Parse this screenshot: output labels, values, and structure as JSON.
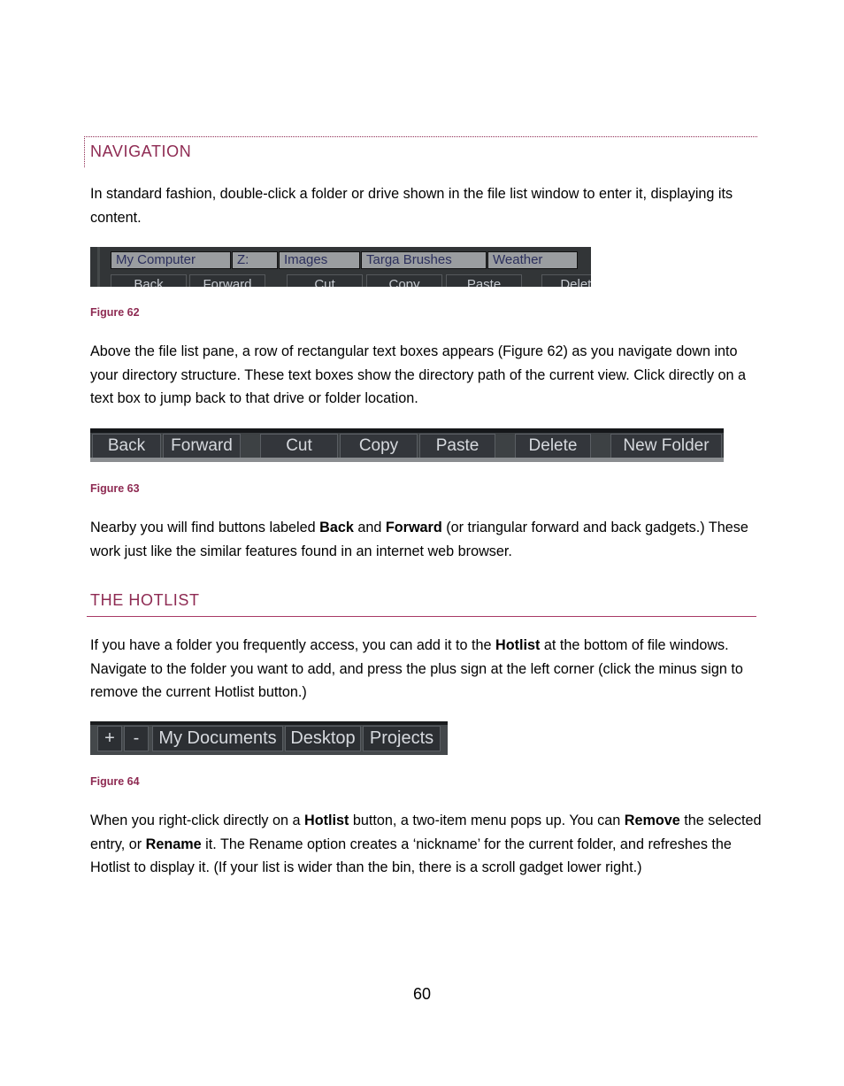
{
  "sections": {
    "navigation": {
      "heading": "NAVIGATION",
      "intro": "In standard fashion, double-click a folder or drive shown in the file list window to enter it, displaying its content."
    },
    "hotlist": {
      "heading": "THE HOTLIST"
    }
  },
  "figures": {
    "fig62": {
      "caption": "Figure 62",
      "path_boxes": [
        "My Computer",
        "Z:",
        "Images",
        "Targa Brushes",
        "Weather"
      ],
      "buttons_partial": [
        "Back",
        "Forward",
        "Cut",
        "Copy",
        "Paste",
        "Delete"
      ]
    },
    "fig63": {
      "caption": "Figure 63",
      "buttons": [
        "Back",
        "Forward",
        "Cut",
        "Copy",
        "Paste",
        "Delete",
        "New Folder"
      ]
    },
    "fig64": {
      "caption": "Figure 64",
      "add_label": "+",
      "remove_label": "-",
      "hotlist_buttons": [
        "My Documents",
        "Desktop",
        "Projects"
      ]
    }
  },
  "paragraphs": {
    "p2": "Above the file list pane, a row of rectangular text boxes appears (Figure 62) as you navigate down into your directory structure.  These text boxes show the directory path of the current view. Click directly on a text box to jump back to that drive or folder location.",
    "p3": {
      "a": "Nearby you will find buttons labeled ",
      "b1": "Back",
      "c": " and ",
      "b2": "Forward",
      "d": " (or triangular forward and back gadgets.) These work just like the similar features found in an internet web browser."
    },
    "p4": {
      "a": "If you have a folder you frequently access, you can add it to the ",
      "b1": "Hotlist",
      "c": " at the bottom of file windows. Navigate to the folder you want to add, and press the plus sign at the left corner (click the minus sign to remove the current Hotlist button.)"
    },
    "p5": {
      "a": "When you right-click directly on a ",
      "b1": "Hotlist",
      "c": " button, a two-item menu pops up.  You can ",
      "b2": "Remove",
      "d": " the selected entry, or ",
      "b3": "Rename",
      "e": " it.  The Rename option creates a ‘nickname’ for the current folder, and refreshes the Hotlist to display it. (If your list is wider than the bin, there is a scroll gadget lower right.)"
    }
  },
  "page_number": "60",
  "colors": {
    "accent": "#8e2a52",
    "ui_dark": "#323537",
    "ui_text": "#d6d9de"
  }
}
